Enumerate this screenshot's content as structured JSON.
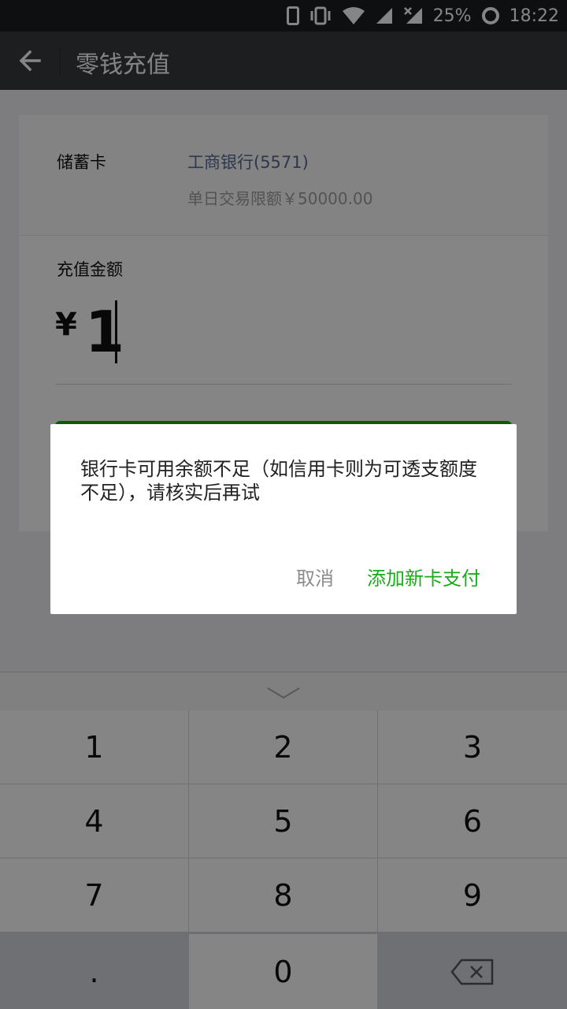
{
  "status_bar": {
    "battery": "25%",
    "time": "18:22"
  },
  "header": {
    "title": "零钱充值"
  },
  "card": {
    "label": "储蓄卡",
    "bank": "工商银行(5571)",
    "limit": "单日交易限额￥50000.00"
  },
  "amount": {
    "label": "充值金额",
    "currency": "¥",
    "value": "1"
  },
  "dialog": {
    "message": "银行卡可用余额不足（如信用卡则为可透支额度不足），请核实后再试",
    "cancel": "取消",
    "add_card": "添加新卡支付"
  },
  "keypad": {
    "keys": [
      "1",
      "2",
      "3",
      "4",
      "5",
      "6",
      "7",
      "8",
      "9",
      ".",
      "0"
    ]
  },
  "colors": {
    "accent": "#1aad19",
    "link": "#576b95",
    "titlebar": "#393a3f"
  },
  "icons": {
    "back": "arrow-left-icon",
    "collapse": "chevron-down-icon",
    "delete": "backspace-icon"
  }
}
